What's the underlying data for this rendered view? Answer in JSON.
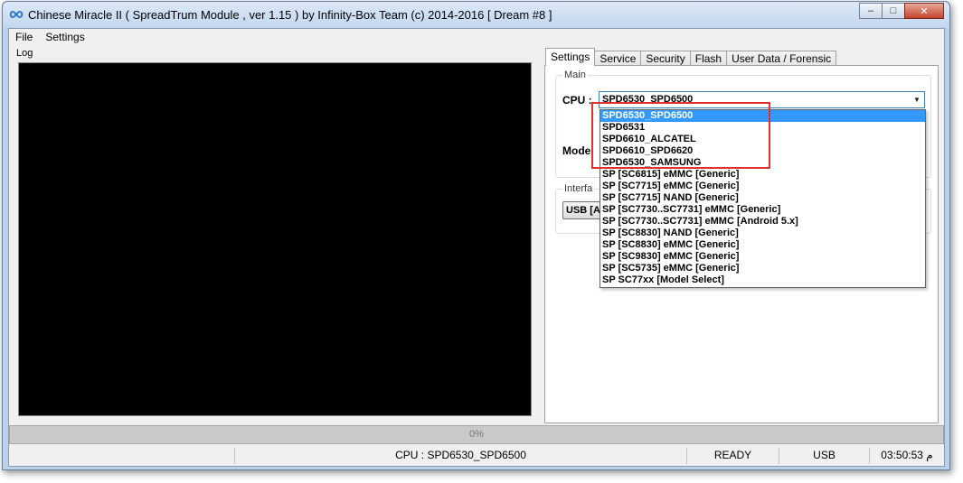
{
  "window": {
    "title": "Chinese Miracle II ( SpreadTrum Module , ver 1.15 ) by Infinity-Box Team (c) 2014-2016 [ Dream #8 ]",
    "caption_minimize": "–",
    "caption_maximize": "□",
    "caption_close": "✕"
  },
  "menu": {
    "file": "File",
    "settings": "Settings"
  },
  "log": {
    "label": "Log"
  },
  "tabs": [
    {
      "label": "Settings",
      "active": true
    },
    {
      "label": "Service"
    },
    {
      "label": "Security"
    },
    {
      "label": "Flash"
    },
    {
      "label": "User Data / Forensic"
    }
  ],
  "settings": {
    "main_group": "Main",
    "cpu_label": "CPU :",
    "model_label": "Model",
    "cpu_selected": "SPD6530_SPD6500",
    "interface_group": "Interfa",
    "usb_button": "USB [A"
  },
  "cpu_options": [
    "SPD6530_SPD6500",
    "SPD6531",
    "SPD6610_ALCATEL",
    "SPD6610_SPD6620",
    "SPD6530_SAMSUNG",
    "SP [SC6815] eMMC [Generic]",
    "SP [SC7715] eMMC [Generic]",
    "SP [SC7715] NAND [Generic]",
    "SP [SC7730..SC7731] eMMC [Generic]",
    "SP [SC7730..SC7731] eMMC [Android 5.x]",
    "SP [SC8830] NAND [Generic]",
    "SP [SC8830] eMMC [Generic]",
    "SP [SC9830] eMMC [Generic]",
    "SP [SC5735] eMMC [Generic]",
    "SP SC77xx [Model Select]"
  ],
  "progress": {
    "text": "0%",
    "value": 0
  },
  "status": {
    "cpu": "CPU : SPD6530_SPD6500",
    "state": "READY",
    "interface": "USB",
    "time": "03:50:53 م"
  },
  "colors": {
    "selection": "#3399ff",
    "highlight_box": "#e03030",
    "log_background": "#000000"
  }
}
